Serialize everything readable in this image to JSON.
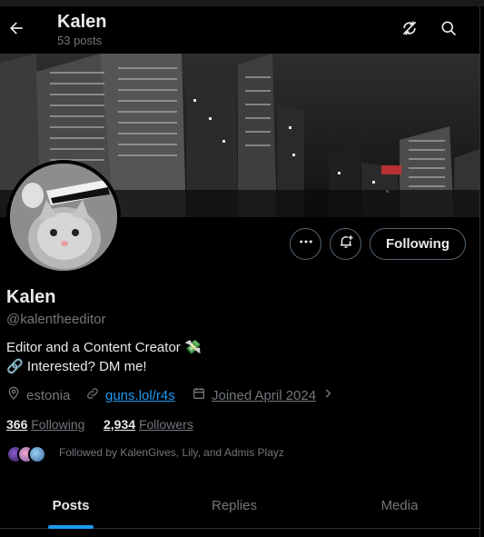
{
  "header": {
    "title": "Kalen",
    "subtitle": "53 posts"
  },
  "icons": {
    "back": "arrow-left-icon",
    "sync": "sync-off-icon",
    "search": "search-icon",
    "more": "more-horizontal-icon",
    "notify": "bell-plus-icon",
    "location": "location-pin-icon",
    "link": "link-icon",
    "calendar": "calendar-icon",
    "chevron": "chevron-right-icon"
  },
  "profile": {
    "following_button": "Following",
    "name": "Kalen",
    "handle": "@kalentheeditor",
    "bio_line1": "Editor and a Content Creator",
    "bio_emoji1": "💸",
    "bio_emoji2": "🔗",
    "bio_line2": "Interested? DM me!",
    "location": "estonia",
    "link": "guns.lol/r4s",
    "joined": "Joined April 2024"
  },
  "stats": {
    "following_count": "366",
    "following_label": "Following",
    "followers_count": "2,934",
    "followers_label": "Followers"
  },
  "mutual": {
    "text": "Followed by KalenGives, Lily, and Admis Playz"
  },
  "tabs": [
    {
      "label": "Posts",
      "active": true
    },
    {
      "label": "Replies",
      "active": false
    },
    {
      "label": "Media",
      "active": false
    }
  ],
  "colors": {
    "accent": "#1d9bf0",
    "text_primary": "#e7e9ea",
    "text_secondary": "#71767b",
    "border": "#536471"
  }
}
